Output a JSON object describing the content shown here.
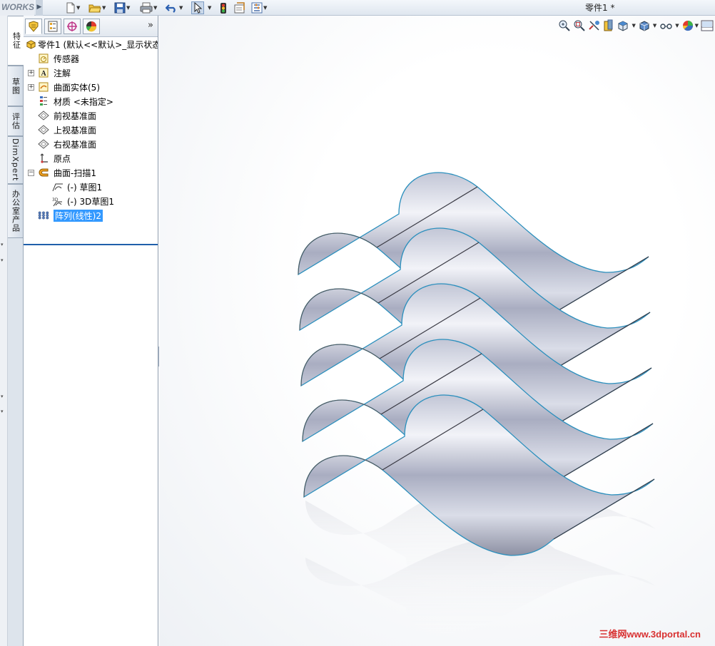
{
  "app": {
    "brand": "WORKS",
    "document_title": "零件1 *"
  },
  "toolbar": {
    "buttons": [
      "new-document-icon",
      "open-folder-icon",
      "save-icon",
      "print-icon",
      "undo-icon",
      "select-cursor-icon",
      "rebuild-traffic-light-icon",
      "options-icon",
      "file-properties-icon"
    ]
  },
  "side_tabs": [
    "特征",
    "草图",
    "评估",
    "DimXpert",
    "办公室产品"
  ],
  "feature_manager": {
    "tabs": [
      "featuremanager-tab-icon",
      "propertymanager-tab-icon",
      "configurationmanager-tab-icon",
      "appearance-tab-icon"
    ],
    "more": "»",
    "tree": [
      {
        "label": "零件1  (默认<<默认>_显示状态",
        "level": 0,
        "icon": "part-icon",
        "expander": ""
      },
      {
        "label": "传感器",
        "level": 1,
        "icon": "sensor-icon",
        "expander": ""
      },
      {
        "label": "注解",
        "level": 1,
        "icon": "annotation-icon",
        "expander": "+"
      },
      {
        "label": "曲面实体(5)",
        "level": 1,
        "icon": "surface-bodies-icon",
        "expander": "+"
      },
      {
        "label": "材质 <未指定>",
        "level": 1,
        "icon": "material-icon",
        "expander": ""
      },
      {
        "label": "前视基准面",
        "level": 1,
        "icon": "plane-icon",
        "expander": ""
      },
      {
        "label": "上视基准面",
        "level": 1,
        "icon": "plane-icon",
        "expander": ""
      },
      {
        "label": "右视基准面",
        "level": 1,
        "icon": "plane-icon",
        "expander": ""
      },
      {
        "label": "原点",
        "level": 1,
        "icon": "origin-icon",
        "expander": ""
      },
      {
        "label": "曲面-扫描1",
        "level": 1,
        "icon": "surface-sweep-icon",
        "expander": "−"
      },
      {
        "label": "(-) 草图1",
        "level": 2,
        "icon": "sketch-icon",
        "expander": ""
      },
      {
        "label": "(-) 3D草图1",
        "level": 2,
        "icon": "3d-sketch-icon",
        "expander": ""
      },
      {
        "label": "阵列(线性)2",
        "level": 1,
        "icon": "linear-pattern-icon",
        "expander": "",
        "selected": true
      }
    ]
  },
  "viewport": {
    "heads_up_icons": [
      "zoom-to-fit-icon",
      "zoom-to-area-icon",
      "previous-view-icon",
      "section-view-icon",
      "view-orientation-icon",
      "display-style-icon",
      "hide-show-items-icon",
      "edit-appearance-icon",
      "apply-scene-icon"
    ],
    "watermark": "三维网www.3dportal.cn",
    "model": {
      "type": "swept surface linear pattern",
      "instances": 5
    }
  },
  "colors": {
    "selection": "#3399ff",
    "surface_edge": "#2a8fbd",
    "surface_light": "#d9dde8",
    "surface_dark": "#8d90a3",
    "rollback_bar": "#1f5faa"
  }
}
